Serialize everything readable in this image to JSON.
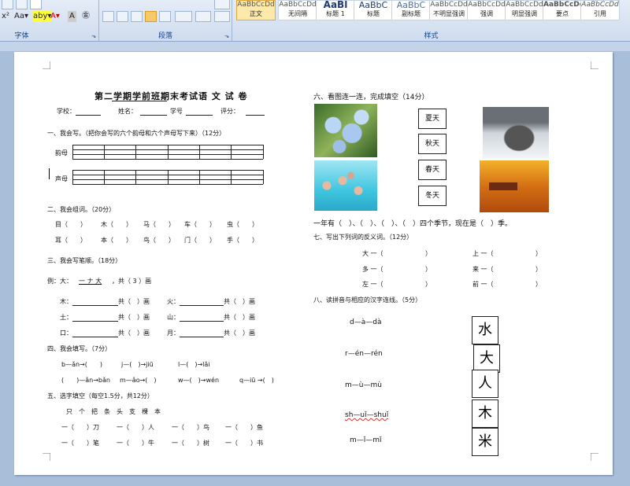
{
  "ribbon": {
    "font_group_label": "字体",
    "paragraph_group_label": "段落",
    "styles_group_label": "样式",
    "font_buttons": [
      "x²",
      "Aa▾",
      "aby▾",
      "A▾",
      "A",
      "㊎"
    ],
    "styles": [
      {
        "preview": "AaBbCcDd",
        "name": "正文"
      },
      {
        "preview": "AaBbCcDd",
        "name": "无间隔"
      },
      {
        "preview": "AaBl",
        "name": "标题 1"
      },
      {
        "preview": "AaBbC",
        "name": "标题"
      },
      {
        "preview": "AaBbC",
        "name": "副标题"
      },
      {
        "preview": "AaBbCcDd",
        "name": "不明显强调"
      },
      {
        "preview": "AaBbCcDd",
        "name": "强调"
      },
      {
        "preview": "AaBbCcDd",
        "name": "明显强调"
      },
      {
        "preview": "AaBbCcDd",
        "name": "要点"
      },
      {
        "preview": "AaBbCcDd",
        "name": "引用"
      }
    ],
    "active_style": "正文"
  },
  "doc": {
    "title": "第二学期学前班期末考试语 文 试 卷",
    "info": {
      "school": "学校：",
      "name": "姓名：",
      "student_no": "学号",
      "score": "评分："
    },
    "s1": {
      "heading": "一、我会写。（把你会写的六个韵母和六个声母写下来）（12分）",
      "yunmu": "韵母",
      "shengmu": "声母"
    },
    "s2": {
      "heading": "二、我会组词。（20分）",
      "row1": [
        "目（　　）",
        "木（　　）",
        "马（　　）",
        "车（　　）",
        "虫（　　）"
      ],
      "row2": [
        "耳（　　）",
        "本（　　）",
        "鸟（　　）",
        "门（　　）",
        "手（　　）"
      ]
    },
    "s3": {
      "heading": "三、我会写笔顺。（18分）",
      "example_prefix": "例：大：",
      "example_strokes": "一 ナ 大",
      "example_suffix": "，共（ 3 ）画",
      "rows": [
        [
          "木：",
          "共（　）画",
          "火：",
          "共（　）画"
        ],
        [
          "土：",
          "共（　）画",
          "山：",
          "共（　）画"
        ],
        [
          "口：",
          "共（　）画",
          "月：",
          "共（　）画"
        ]
      ]
    },
    "s4": {
      "heading": "四、我会填写。（7分）",
      "row1": [
        "b—ǎn→(　　)",
        "j—(　)→jiū",
        "l—(　)→lǎi"
      ],
      "row2": [
        "(　　)—ǎn→bǎn",
        "m—ǎo→(　)",
        "w—(　)→wén",
        "q—iū →(　)"
      ]
    },
    "s5": {
      "heading": "五、选字填空（每空1.5分，共12分）",
      "chars": "只　个　把　条　头　支　棵　本",
      "row1": [
        "一（　　）刀",
        "一（　　）人",
        "一（　　）鸟",
        "一（　　）鱼"
      ],
      "row2": [
        "一（　　）笔",
        "一（　　）牛",
        "一（　　）树",
        "一（　　）书"
      ]
    },
    "s6": {
      "heading": "六、看图连一连，完成填空（14分）",
      "seasons": [
        "夏天",
        "秋天",
        "春天",
        "冬天"
      ],
      "sentence": "一年有（　）、（　）、（　）、（　）四个季节，现在是（　）季。"
    },
    "s7": {
      "heading": "七、写出下列词的反义词。（12分）",
      "pairs": [
        [
          "大 一（",
          "）",
          "上 一（",
          "）"
        ],
        [
          "多 一（",
          "）",
          "来 一（",
          "）"
        ],
        [
          "左 一（",
          "）",
          "前 一（",
          "）"
        ]
      ]
    },
    "s8": {
      "heading": "八、读拼音与相应的汉字连线。（5分）",
      "pinyin": [
        "d—à—dà",
        "r—én—rén",
        "m—ù—mù",
        "sh—uǐ—shuǐ",
        "m—ǐ—mǐ"
      ],
      "chars": [
        "水",
        "大",
        "人",
        "木",
        "米"
      ]
    }
  }
}
